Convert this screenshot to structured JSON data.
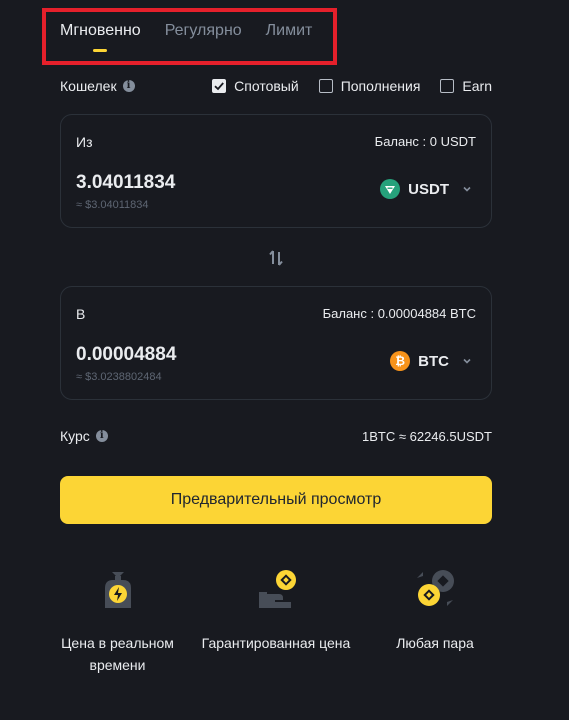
{
  "tabs": [
    {
      "label": "Мгновенно",
      "active": true
    },
    {
      "label": "Регулярно",
      "active": false
    },
    {
      "label": "Лимит",
      "active": false
    }
  ],
  "wallet": {
    "label": "Кошелек",
    "options": [
      {
        "label": "Спотовый",
        "checked": true
      },
      {
        "label": "Пополнения",
        "checked": false
      },
      {
        "label": "Earn",
        "checked": false
      }
    ]
  },
  "from": {
    "label": "Из",
    "balance": "Баланс : 0 USDT",
    "amount": "3.04011834",
    "approx": "≈ $3.04011834",
    "coin": "USDT",
    "icon": "tether-icon"
  },
  "to": {
    "label": "В",
    "balance": "Баланс : 0.00004884 BTC",
    "amount": "0.00004884",
    "approx": "≈ $3.0238802484",
    "coin": "BTC",
    "icon": "bitcoin-icon"
  },
  "rate": {
    "label": "Курс",
    "value": "1BTC ≈ 62246.5USDT"
  },
  "preview_button": "Предварительный просмотр",
  "features": [
    {
      "label": "Цена в реальном времени",
      "icon": "lightning-bag-icon"
    },
    {
      "label": "Гарантированная цена",
      "icon": "hand-coin-icon"
    },
    {
      "label": "Любая пара",
      "icon": "coin-pair-icon"
    }
  ],
  "colors": {
    "background": "#181a20",
    "accent": "#fcd535",
    "highlight": "#e5202b",
    "usdt": "#26a17b",
    "btc": "#f7931a"
  }
}
